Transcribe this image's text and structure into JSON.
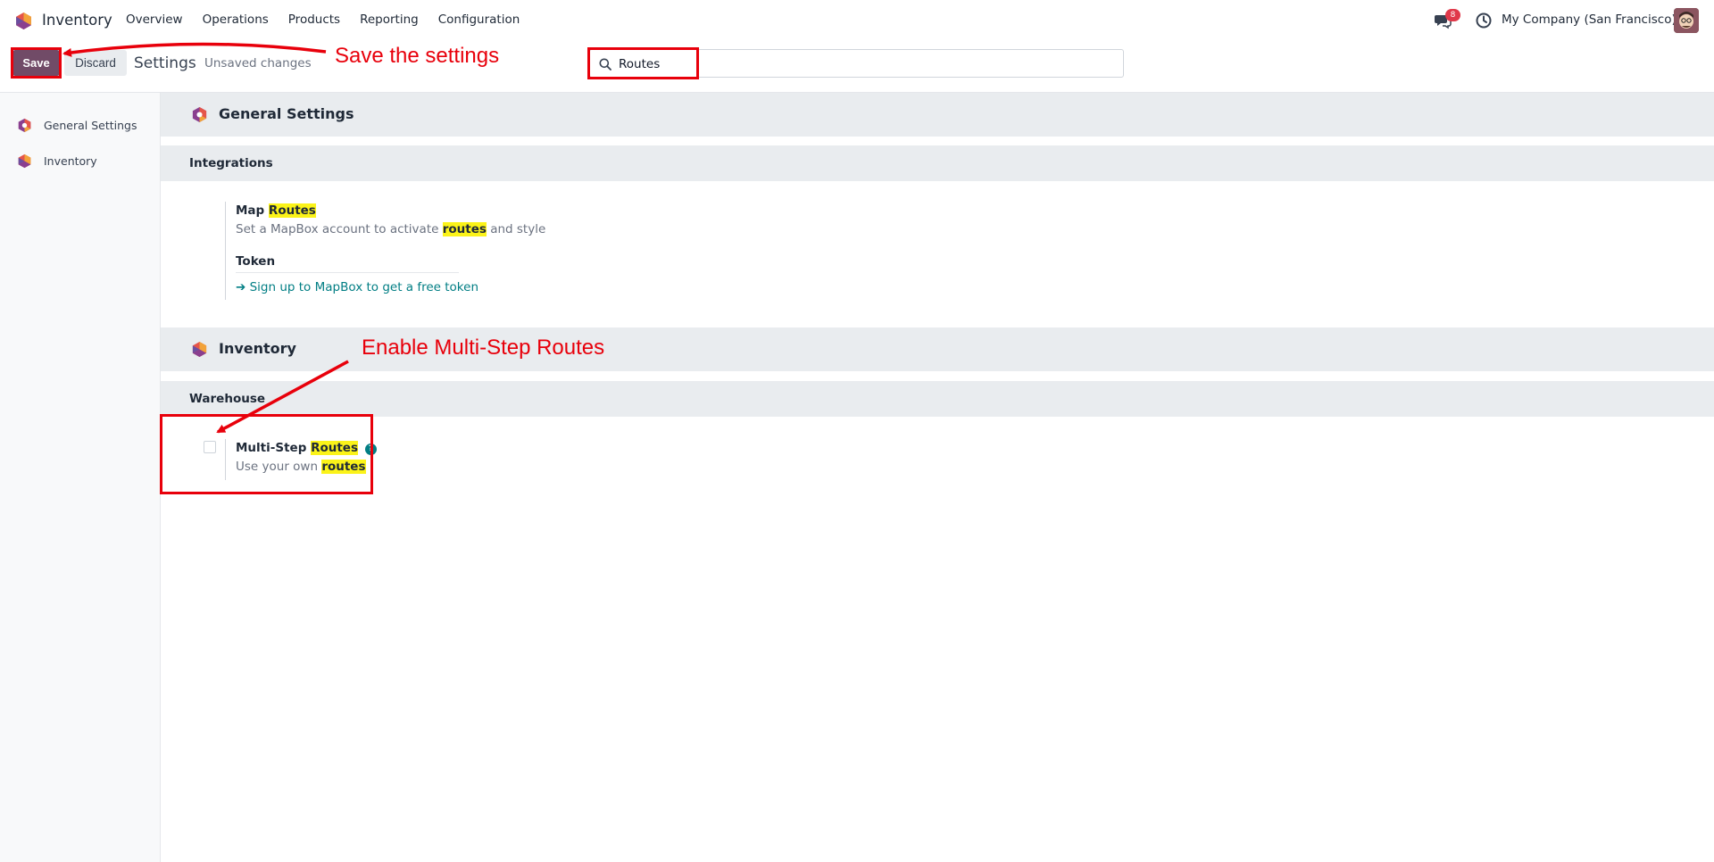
{
  "navbar": {
    "app_name": "Inventory",
    "menu": [
      "Overview",
      "Operations",
      "Products",
      "Reporting",
      "Configuration"
    ],
    "chat_count": "8",
    "company": "My Company (San Francisco)"
  },
  "control_panel": {
    "save_label": "Save",
    "discard_label": "Discard",
    "title": "Settings",
    "unsaved": "Unsaved changes",
    "search_value": "Routes"
  },
  "sidebar": {
    "items": [
      {
        "label": "General Settings"
      },
      {
        "label": "Inventory"
      }
    ]
  },
  "general_settings": {
    "header": "General Settings",
    "section": "Integrations",
    "map_title_prefix": "Map ",
    "map_title_hl": "Routes",
    "map_desc_prefix": "Set a MapBox account to activate ",
    "map_desc_hl": "routes",
    "map_desc_suffix": " and style",
    "token_label": "Token",
    "token_link": "➔ Sign up to MapBox to get a free token"
  },
  "inventory_settings": {
    "header": "Inventory",
    "section": "Warehouse",
    "ms_title_prefix": "Multi-Step ",
    "ms_title_hl": "Routes",
    "ms_desc_prefix": "Use your own ",
    "ms_desc_hl": "routes",
    "ms_checked": false
  },
  "annotations": {
    "save_note": "Save the settings",
    "enable_note": "Enable Multi-Step Routes",
    "color": "#e8000b"
  },
  "colors": {
    "brand": "#714b67",
    "link": "#017e84",
    "highlight": "#fbf319",
    "badge": "#e0394a"
  }
}
